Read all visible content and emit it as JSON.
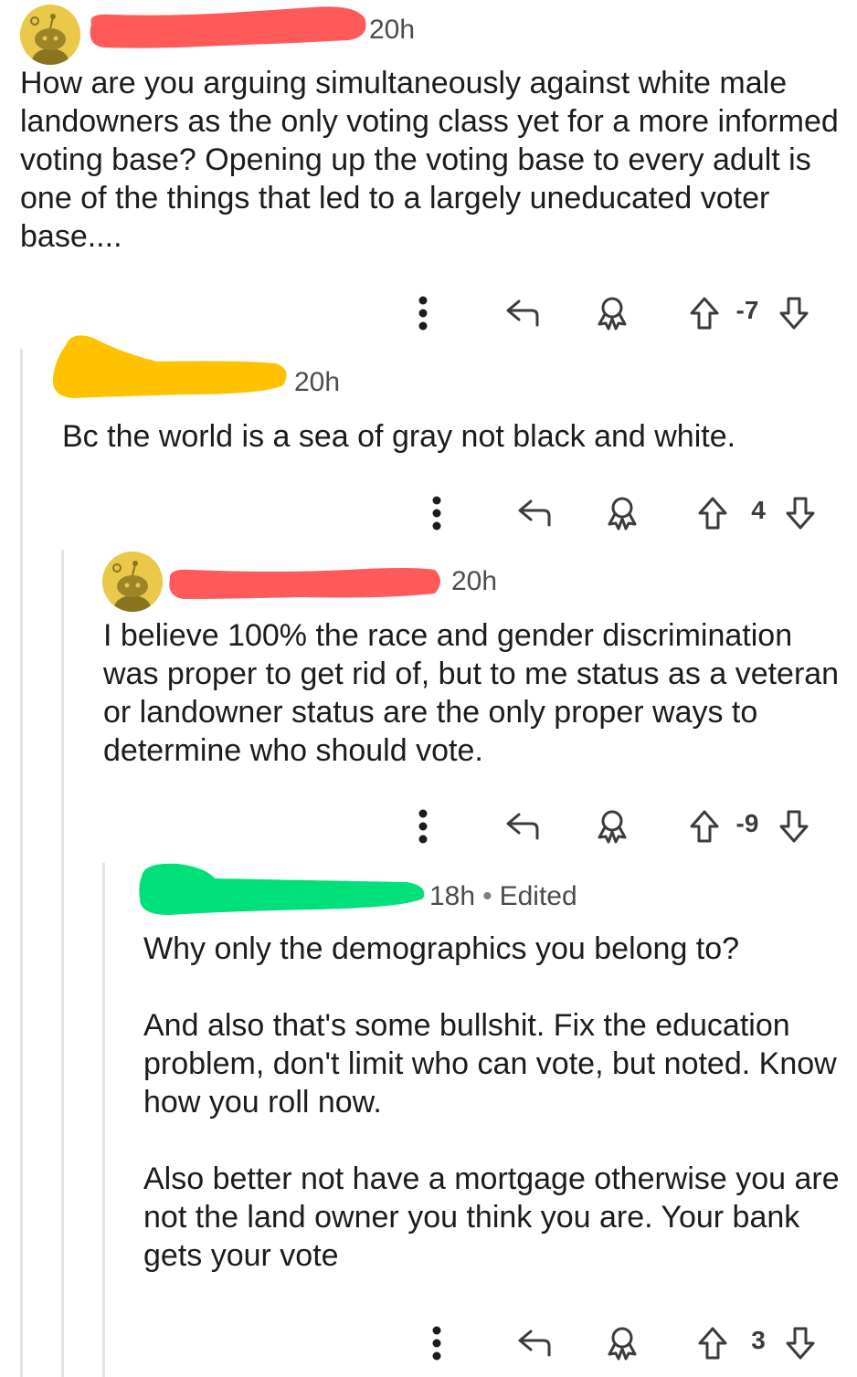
{
  "comments": [
    {
      "time": "20h",
      "edited": "",
      "paragraphs": [
        "How are you arguing simultaneously against white male landowners as the only voting class yet for a more informed voting base? Opening up the voting base to every adult is one of the things that led to a largely uneducated voter base...."
      ],
      "score": "-7",
      "redaction_color": "#ff5a5a"
    },
    {
      "time": "20h",
      "edited": "",
      "paragraphs": [
        "Bc the world is a sea of gray not black and white."
      ],
      "score": "4",
      "redaction_color": "#ffc200"
    },
    {
      "time": "20h",
      "edited": "",
      "paragraphs": [
        "I believe 100% the race and gender discrimination was proper to get rid of, but to me status as a veteran or landowner status are the only proper ways to determine who should vote."
      ],
      "score": "-9",
      "redaction_color": "#ff5a5a"
    },
    {
      "time": "18h",
      "edited": "Edited",
      "paragraphs": [
        "Why only the demographics you belong to?",
        "And also that's some bullshit. Fix the education problem, don't limit who can vote, but noted. Know how you roll now.",
        "Also better not have a mortgage otherwise you are not the land owner you think you are. Your bank gets your vote"
      ],
      "score": "3",
      "redaction_color": "#00e07a"
    }
  ],
  "icons": {
    "more": "more-options-icon",
    "reply": "reply-icon",
    "award": "award-icon",
    "upvote": "upvote-arrow-icon",
    "downvote": "downvote-arrow-icon"
  },
  "colors": {
    "avatar": "#e9c84a",
    "thread_line": "#e4e4e4",
    "text": "#1c1c1c",
    "meta": "#4c4c4c"
  }
}
